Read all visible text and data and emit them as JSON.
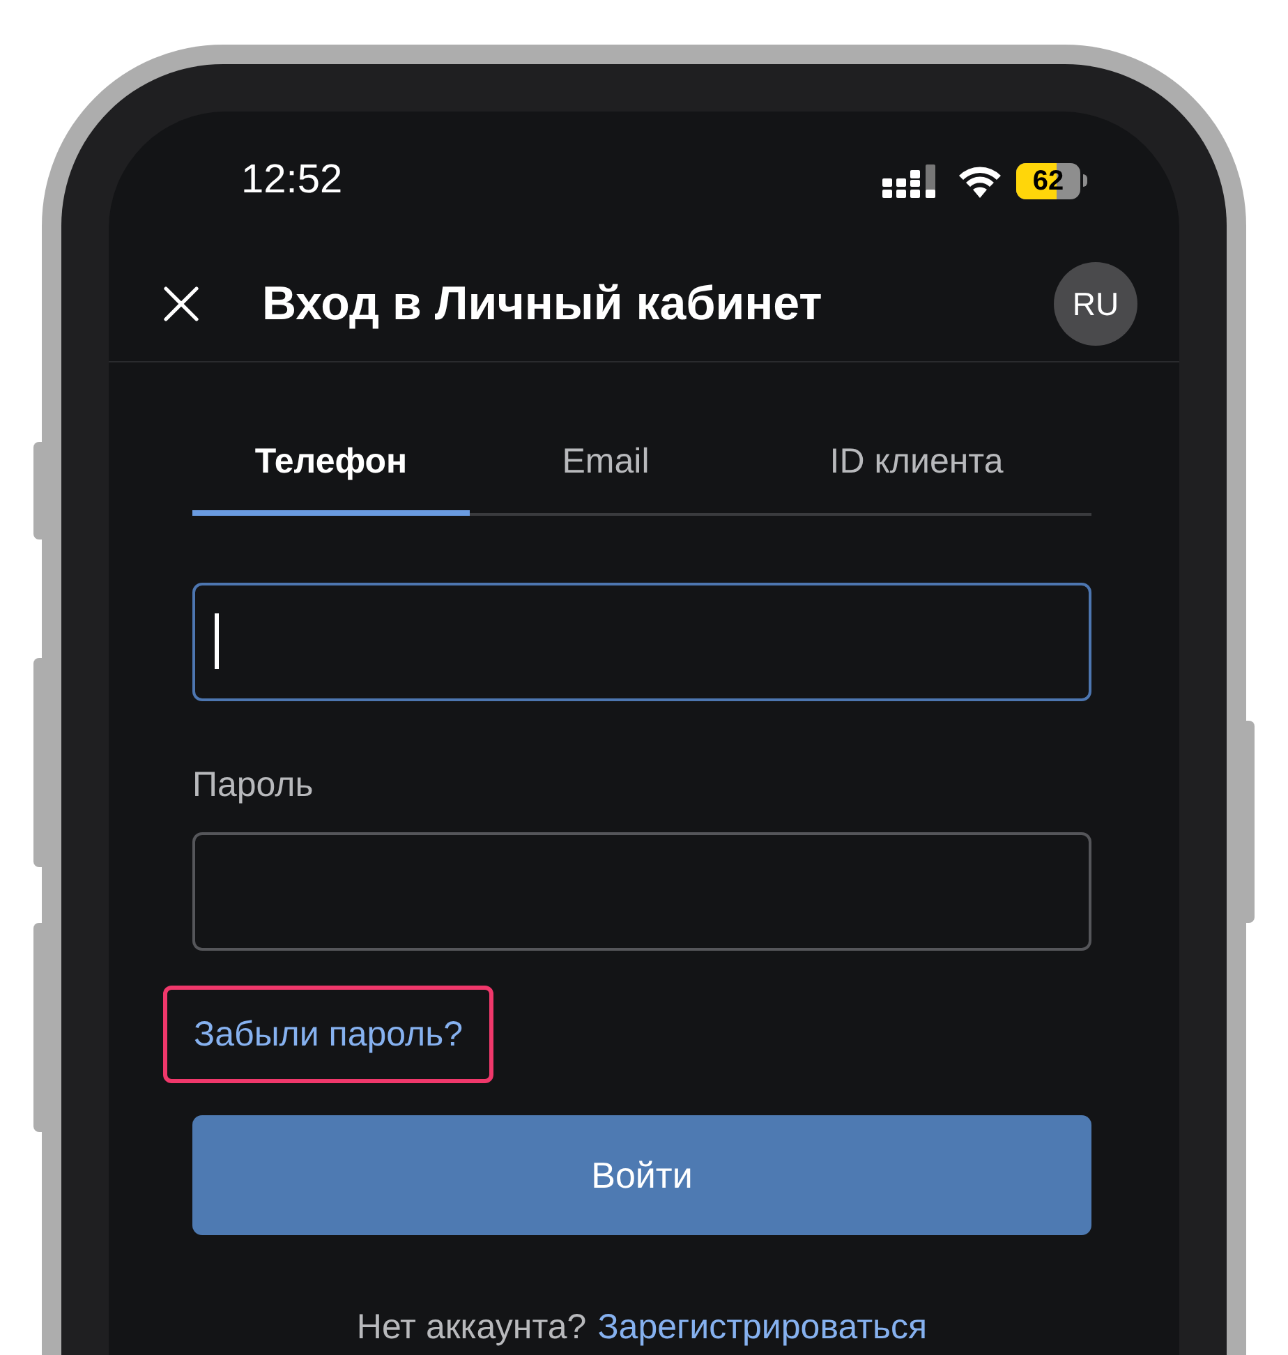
{
  "status_bar": {
    "time": "12:52",
    "battery": {
      "text": "62",
      "level": 0.62
    }
  },
  "header": {
    "title": "Вход в Личный кабинет",
    "language": "RU"
  },
  "tabs": [
    {
      "label": "Телефон",
      "selected": true
    },
    {
      "label": "Email",
      "selected": false
    },
    {
      "label": "ID клиента",
      "selected": false
    }
  ],
  "login_field": {
    "focused": true
  },
  "password": {
    "label": "Пароль"
  },
  "forgot_link": {
    "label": "Забыли пароль?",
    "highlighted": true
  },
  "submit_button": {
    "label": "Войти"
  },
  "footer": {
    "text": "Нет аккаунта?",
    "link": "Зарегистрироваться"
  }
}
